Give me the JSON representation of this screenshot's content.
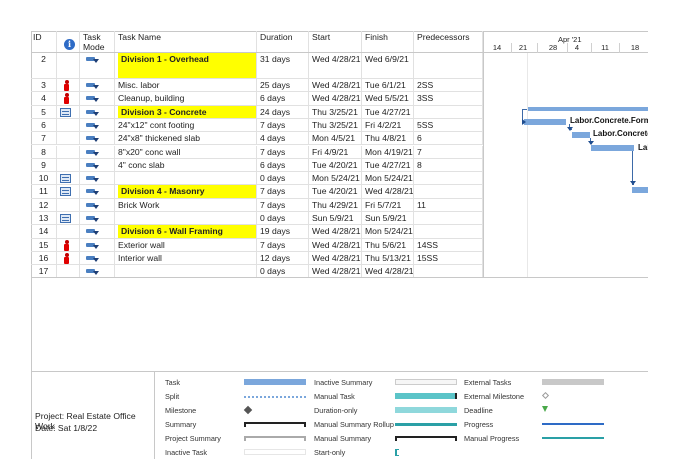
{
  "header": {
    "id": "ID",
    "indicator_icon": "info-icon",
    "task_mode": "Task Mode",
    "task_name": "Task Name",
    "duration": "Duration",
    "start": "Start",
    "finish": "Finish",
    "predecessors": "Predecessors"
  },
  "rows": [
    {
      "id": "2",
      "ind": "",
      "name": "Division 1 - Overhead",
      "summary": true,
      "duration": "31 days",
      "start": "Wed 4/28/21",
      "finish": "Wed 6/9/21",
      "pred": ""
    },
    {
      "id": "3",
      "ind": "person",
      "name": "Misc. labor",
      "summary": false,
      "duration": "25 days",
      "start": "Wed 4/28/21",
      "finish": "Tue 6/1/21",
      "pred": "2SS"
    },
    {
      "id": "4",
      "ind": "person",
      "name": "Cleanup, building",
      "summary": false,
      "duration": "6 days",
      "start": "Wed 4/28/21",
      "finish": "Wed 5/5/21",
      "pred": "3SS"
    },
    {
      "id": "5",
      "ind": "calendar",
      "name": "Division 3 - Concrete",
      "summary": true,
      "duration": "24 days",
      "start": "Thu 3/25/21",
      "finish": "Tue 4/27/21",
      "pred": ""
    },
    {
      "id": "6",
      "ind": "",
      "name": "24\"x12\" cont footing",
      "summary": false,
      "duration": "7 days",
      "start": "Thu 3/25/21",
      "finish": "Fri 4/2/21",
      "pred": "5SS"
    },
    {
      "id": "7",
      "ind": "",
      "name": "24\"x8\" thickened slab",
      "summary": false,
      "duration": "4 days",
      "start": "Mon 4/5/21",
      "finish": "Thu 4/8/21",
      "pred": "6"
    },
    {
      "id": "8",
      "ind": "",
      "name": "8\"x20\" conc wall",
      "summary": false,
      "duration": "7 days",
      "start": "Fri 4/9/21",
      "finish": "Mon 4/19/21",
      "pred": "7"
    },
    {
      "id": "9",
      "ind": "",
      "name": "4\" conc slab",
      "summary": false,
      "duration": "6 days",
      "start": "Tue 4/20/21",
      "finish": "Tue 4/27/21",
      "pred": "8"
    },
    {
      "id": "10",
      "ind": "calendar",
      "name": "",
      "summary": false,
      "duration": "0 days",
      "start": "Mon 5/24/21",
      "finish": "Mon 5/24/21",
      "pred": ""
    },
    {
      "id": "11",
      "ind": "calendar",
      "name": "Division 4 - Masonry",
      "summary": true,
      "duration": "7 days",
      "start": "Tue 4/20/21",
      "finish": "Wed 4/28/21",
      "pred": ""
    },
    {
      "id": "12",
      "ind": "",
      "name": "Brick Work",
      "summary": false,
      "duration": "7 days",
      "start": "Thu 4/29/21",
      "finish": "Fri 5/7/21",
      "pred": "11"
    },
    {
      "id": "13",
      "ind": "calendar",
      "name": "",
      "summary": false,
      "duration": "0 days",
      "start": "Sun 5/9/21",
      "finish": "Sun 5/9/21",
      "pred": ""
    },
    {
      "id": "14",
      "ind": "",
      "name": "Division 6 - Wall Framing",
      "summary": true,
      "duration": "19 days",
      "start": "Wed 4/28/21",
      "finish": "Mon 5/24/21",
      "pred": ""
    },
    {
      "id": "15",
      "ind": "person",
      "name": "Exterior wall",
      "summary": false,
      "duration": "7 days",
      "start": "Wed 4/28/21",
      "finish": "Thu 5/6/21",
      "pred": "14SS"
    },
    {
      "id": "16",
      "ind": "person",
      "name": "Interior wall",
      "summary": false,
      "duration": "12 days",
      "start": "Wed 4/28/21",
      "finish": "Thu 5/13/21",
      "pred": "15SS"
    },
    {
      "id": "17",
      "ind": "",
      "name": "",
      "summary": false,
      "duration": "0 days",
      "start": "Wed 4/28/21",
      "finish": "Wed 4/28/21",
      "pred": ""
    }
  ],
  "gantt": {
    "month_label": "Apr '21",
    "days": [
      "14",
      "21",
      "28",
      "4",
      "11",
      "18"
    ],
    "bar_labels": [
      "Labor.Concrete.Form",
      "Labor.Concrete",
      "Lab"
    ]
  },
  "legend": {
    "project_line": "Project: Real Estate Office Work",
    "date_line": "Date: Sat 1/8/22",
    "col1": [
      "Task",
      "Split",
      "Milestone",
      "Summary",
      "Project Summary",
      "Inactive Task"
    ],
    "col2": [
      "Inactive Summary",
      "Manual Task",
      "Duration-only",
      "Manual Summary Rollup",
      "Manual Summary",
      "Start-only"
    ],
    "col3": [
      "External Tasks",
      "External Milestone",
      "Deadline",
      "Progress",
      "Manual Progress"
    ]
  },
  "colors": {
    "summary_highlight": "#ffff00",
    "task_bar": "#7ba7dc",
    "manual_task": "#5bc4c8",
    "indicator_person": "#e00000"
  }
}
